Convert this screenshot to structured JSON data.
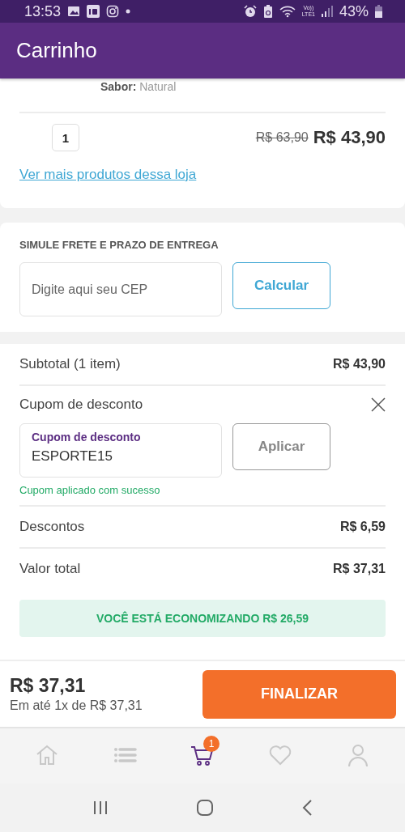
{
  "status_bar": {
    "time": "13:53",
    "network_top": "Vo))",
    "network_bottom": "LTE1",
    "battery": "43%"
  },
  "app_bar": {
    "title": "Carrinho"
  },
  "product": {
    "attribute_label": "Sabor:",
    "attribute_value": "Natural",
    "quantity": "1",
    "old_price": "R$ 63,90",
    "price": "R$ 43,90",
    "store_link": "Ver mais produtos dessa loja"
  },
  "shipping": {
    "title": "SIMULE FRETE E PRAZO DE ENTREGA",
    "cep_placeholder": "Digite aqui seu CEP",
    "button": "Calcular"
  },
  "summary": {
    "subtotal_label": "Subtotal (1 item)",
    "subtotal_value": "R$ 43,90",
    "coupon_title": "Cupom de desconto",
    "coupon_field": {
      "label": "Cupom de desconto",
      "value": "ESPORTE15"
    },
    "coupon_button": {
      "label": "Aplicar",
      "disabled": true
    },
    "coupon_message": "Cupom aplicado com sucesso",
    "rows": [
      {
        "label": "Descontos",
        "value": "R$ 6,59"
      },
      {
        "label": "Valor total",
        "value": "R$ 37,31"
      }
    ],
    "savings_banner": "VOCÊ ESTÁ ECONOMIZANDO R$ 26,59"
  },
  "checkout": {
    "total": "R$ 37,31",
    "installments": "Em até 1x de R$ 37,31",
    "button": "FINALIZAR"
  },
  "bottom_nav": [
    {
      "kind": "home",
      "selected": false
    },
    {
      "kind": "list",
      "selected": false
    },
    {
      "kind": "cart",
      "selected": true,
      "badge": "1"
    },
    {
      "kind": "heart",
      "selected": false
    },
    {
      "kind": "person",
      "selected": false
    }
  ]
}
